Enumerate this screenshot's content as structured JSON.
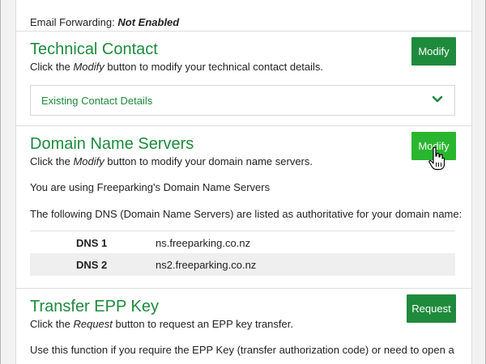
{
  "email_forwarding": {
    "label": "Email Forwarding:",
    "value": "Not Enabled"
  },
  "technical_contact": {
    "title": "Technical Contact",
    "description_prefix": "Click the ",
    "description_em": "Modify",
    "description_suffix": " button to modify your technical contact details.",
    "button_label": "Modify",
    "accordion_label": "Existing Contact Details"
  },
  "domain_name_servers": {
    "title": "Domain Name Servers",
    "description_prefix": "Click the ",
    "description_em": "Modify",
    "description_suffix": " button to modify your domain name servers.",
    "button_label": "Modify",
    "using_text": "You are using Freeparking's Domain Name Servers",
    "listed_text": "The following DNS (Domain Name Servers) are listed as authoritative for your domain name:",
    "dns": [
      {
        "label": "DNS 1",
        "value": "ns.freeparking.co.nz"
      },
      {
        "label": "DNS 2",
        "value": "ns2.freeparking.co.nz"
      }
    ]
  },
  "transfer_epp": {
    "title": "Transfer EPP Key",
    "description_prefix": "Click the ",
    "description_em": "Request",
    "description_suffix": " button to request an EPP key transfer.",
    "button_label": "Request",
    "use_text": "Use this function if you require the EPP Key (transfer authorization code) or need to open a"
  },
  "colors": {
    "accent": "#1e8a3c",
    "button_hover": "#29b62e",
    "row_alt": "#efefef"
  },
  "icons": [
    "chevron-down-icon",
    "hand-pointer-icon"
  ]
}
